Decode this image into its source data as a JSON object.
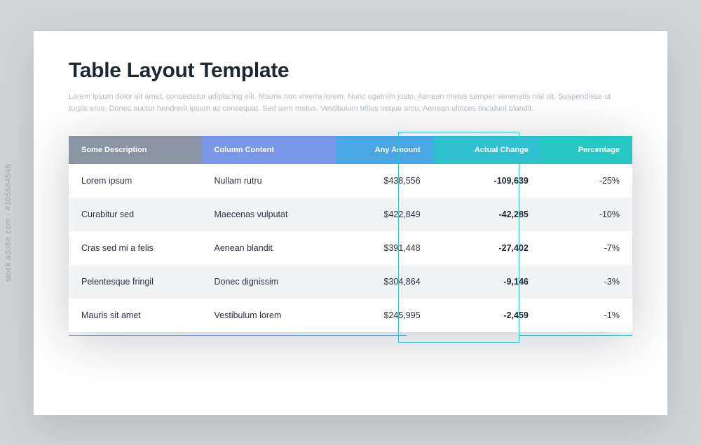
{
  "title": "Table Layout Template",
  "subtitle": "Lorem ipsum dolor sit amet, consectetur adipiscing elit. Mauris non viverra lorem. Nunc egetnim justo. Aenean metus semper venenatis nisl sit. Suspendisse ut turpis eros. Donec auctor hendrerit ipsum ac consequat. Sed sem metus. Vestibulum tellus neque arcu. Aenean ultrices tincidunt blandit.",
  "watermark": "stock.adobe.com · #305684548",
  "columns": [
    "Some Description",
    "Column Content",
    "Any Amount",
    "Actual Change",
    "Percentage"
  ],
  "rows": [
    {
      "c0": "Lorem ipsum",
      "c1": "Nullam rutru",
      "c2": "$438,556",
      "c3": "-109,639",
      "c4": "-25%"
    },
    {
      "c0": "Curabitur sed",
      "c1": "Maecenas vulputat",
      "c2": "$422,849",
      "c3": "-42,285",
      "c4": "-10%"
    },
    {
      "c0": "Cras sed mi a felis",
      "c1": "Aenean blandit",
      "c2": "$391,448",
      "c3": "-27,402",
      "c4": "-7%"
    },
    {
      "c0": "Pelentesque fringil",
      "c1": "Donec dignissim",
      "c2": "$304,864",
      "c3": "-9,146",
      "c4": "-3%"
    },
    {
      "c0": "Mauris sit amet",
      "c1": "Vestibulum lorem",
      "c2": "$245,995",
      "c3": "-2,459",
      "c4": "-1%"
    }
  ],
  "chart_data": {
    "type": "table",
    "columns": [
      "Some Description",
      "Column Content",
      "Any Amount",
      "Actual Change",
      "Percentage"
    ],
    "rows": [
      [
        "Lorem ipsum",
        "Nullam rutru",
        438556,
        -109639,
        -25
      ],
      [
        "Curabitur sed",
        "Maecenas vulputat",
        422849,
        -42285,
        -10
      ],
      [
        "Cras sed mi a felis",
        "Aenean blandit",
        391448,
        -27402,
        -7
      ],
      [
        "Pelentesque fringil",
        "Donec dignissim",
        304864,
        -9146,
        -3
      ],
      [
        "Mauris sit amet",
        "Vestibulum lorem",
        245995,
        -2459,
        -1
      ]
    ]
  }
}
